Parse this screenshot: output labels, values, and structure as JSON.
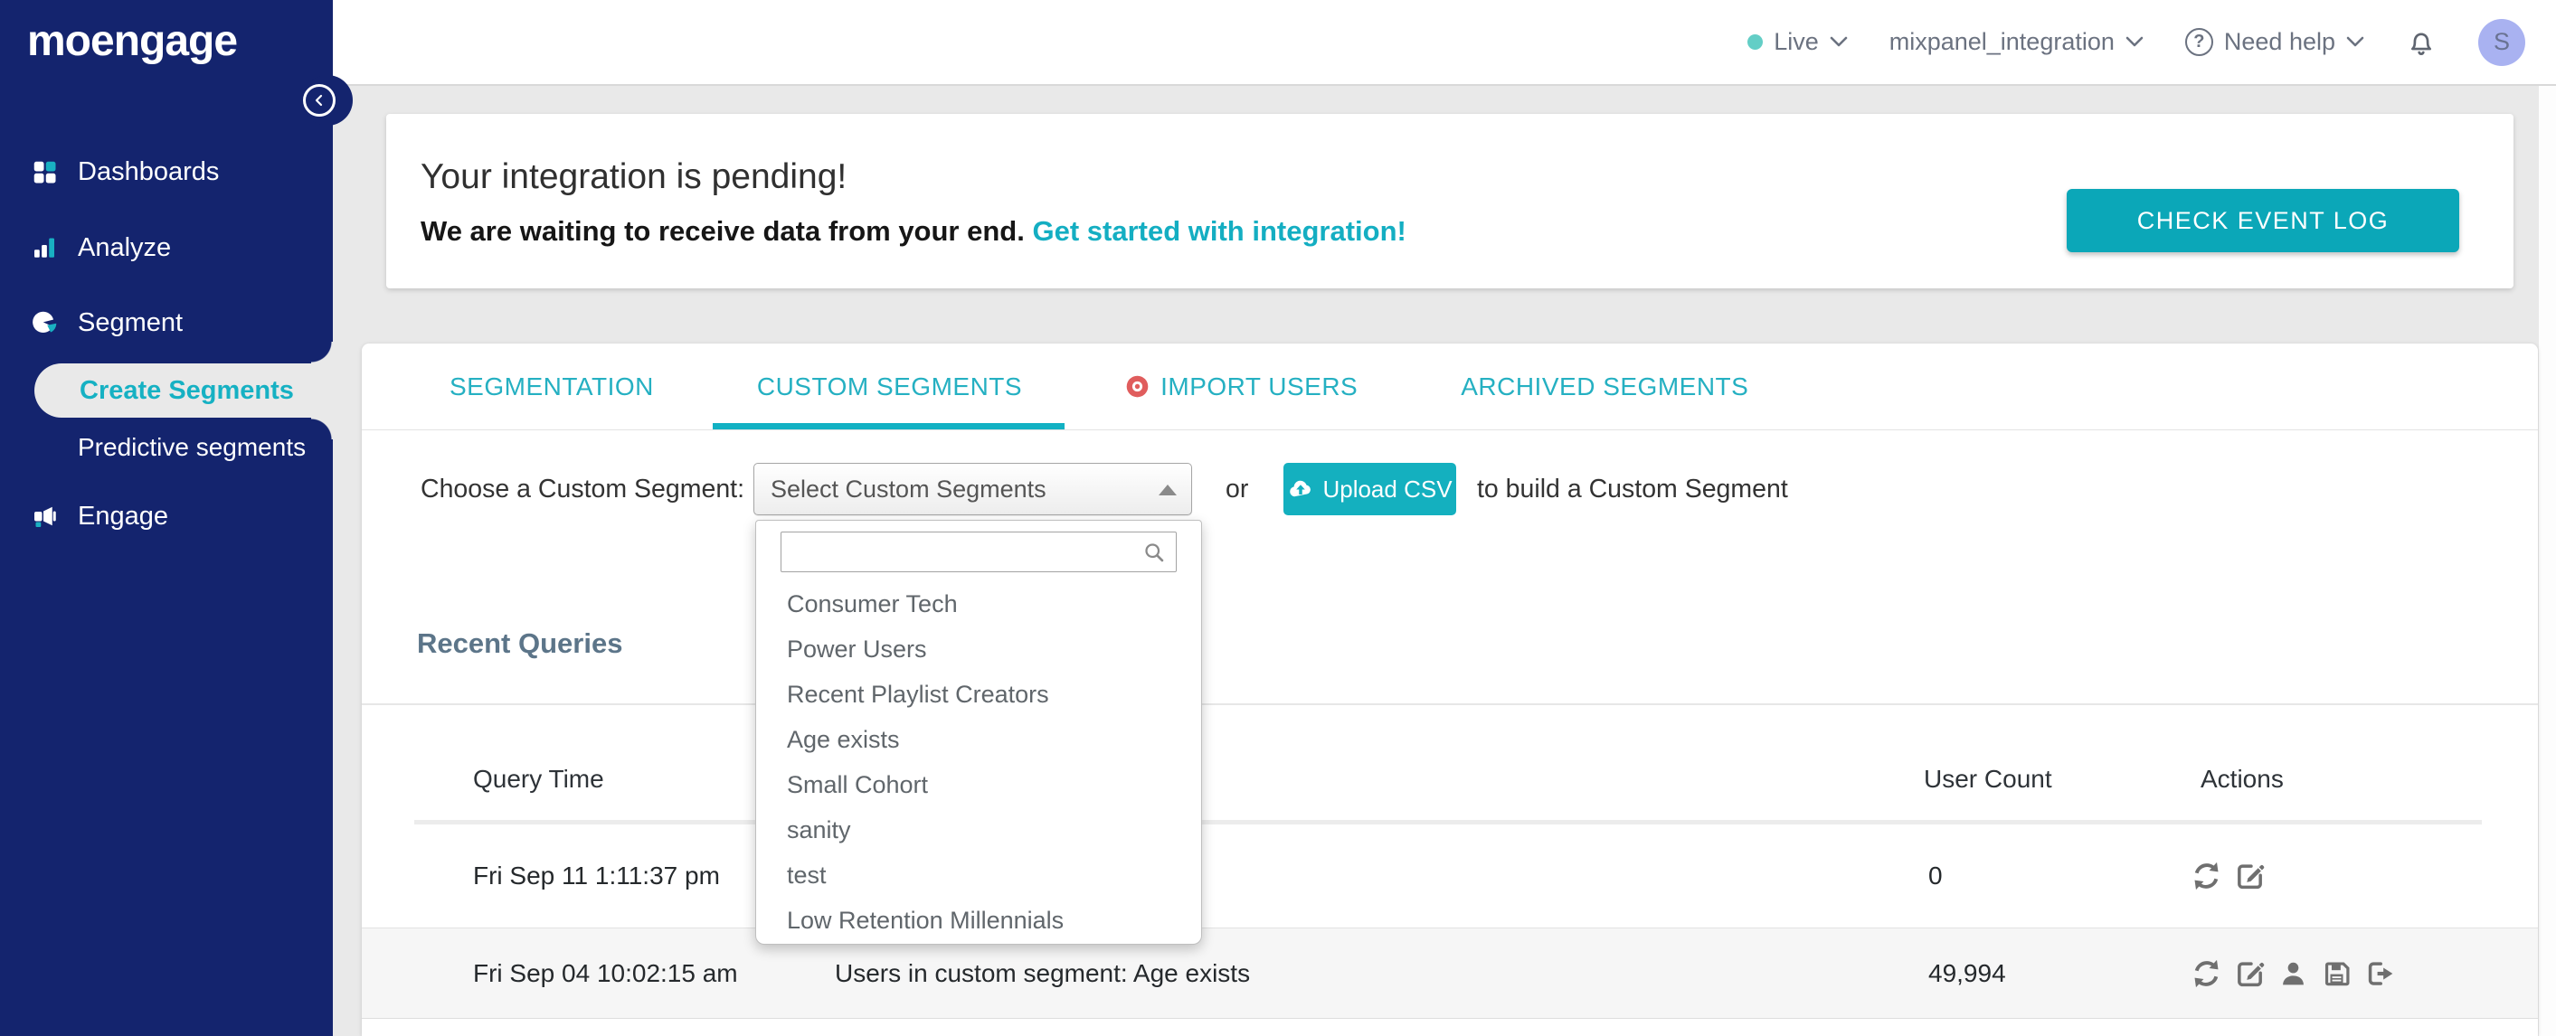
{
  "sidebar": {
    "logo": "moengage",
    "items": [
      {
        "label": "Dashboards"
      },
      {
        "label": "Analyze"
      },
      {
        "label": "Segment"
      },
      {
        "label": "Create Segments",
        "active": true
      },
      {
        "label": "Predictive segments"
      },
      {
        "label": "Engage"
      }
    ]
  },
  "header": {
    "env_label": "Live",
    "workspace": "mixpanel_integration",
    "help_label": "Need help",
    "help_icon": "?",
    "avatar_initial": "S"
  },
  "banner": {
    "title": "Your integration is pending!",
    "subtitle": "We are waiting to receive data from your end.",
    "link": "Get started with integration!",
    "button": "CHECK EVENT LOG"
  },
  "tabs": [
    {
      "label": "SEGMENTATION",
      "active": false
    },
    {
      "label": "CUSTOM SEGMENTS",
      "active": true
    },
    {
      "label": "IMPORT USERS",
      "active": false,
      "badge": "red-target-icon"
    },
    {
      "label": "ARCHIVED SEGMENTS",
      "active": false
    }
  ],
  "segment_picker": {
    "label": "Choose a Custom Segment:",
    "select_value": "Select Custom Segments",
    "or_text": "or",
    "upload_button": "Upload CSV",
    "suffix_text": "to build a Custom Segment",
    "dropdown": {
      "search_value": "",
      "options": [
        "Consumer Tech",
        "Power Users",
        "Recent Playlist Creators",
        "Age exists",
        "Small Cohort",
        "sanity",
        "test",
        "Low Retention Millennials"
      ]
    }
  },
  "recent_queries": {
    "title": "Recent Queries",
    "columns": [
      "Query Time",
      "User Count",
      "Actions"
    ],
    "rows": [
      {
        "time": "Fri Sep 11 1:11:37 pm",
        "description": "",
        "user_count": "0",
        "actions": [
          "refresh",
          "edit"
        ]
      },
      {
        "time": "Fri Sep 04 10:02:15 am",
        "description": "Users in custom segment: Age exists",
        "user_count": "49,994",
        "actions": [
          "refresh",
          "edit",
          "user",
          "save",
          "export"
        ]
      }
    ]
  },
  "colors": {
    "sidebar_navy": "#14246e",
    "accent_teal": "#14b0bf",
    "teal_text": "#25b0c2",
    "badge_red": "#e05d5d",
    "heading_slate": "#5c7589",
    "avatar_bg": "#a9b2f1",
    "live_dot": "#63cec6",
    "page_bg": "#e9e9e9"
  }
}
